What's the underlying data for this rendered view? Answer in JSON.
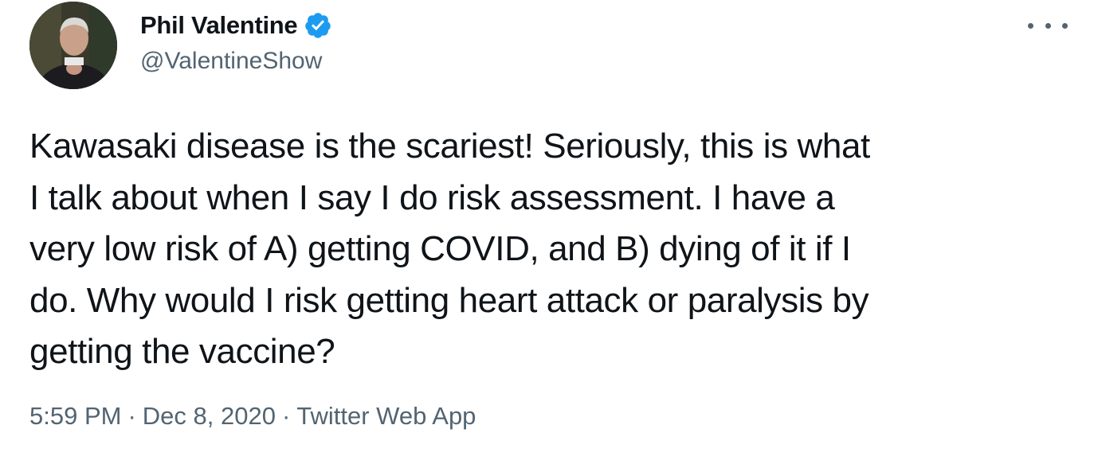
{
  "author": {
    "display_name": "Phil Valentine",
    "handle": "@ValentineShow",
    "verified": true,
    "verified_color": "#1d9bf0"
  },
  "tweet": {
    "text_lines": [
      "Kawasaki disease is the scariest! Seriously, this is what",
      "I talk about when I say I do risk assessment. I have a",
      "very low risk of A) getting COVID, and B) dying of it if I",
      "do. Why would I risk getting heart attack or paralysis by",
      "getting the vaccine?"
    ]
  },
  "meta": {
    "time": "5:59 PM",
    "separator": "·",
    "date": "Dec 8, 2020",
    "source": "Twitter Web App"
  },
  "icons": {
    "more": "more-horizontal-icon",
    "verified": "verified-badge-icon"
  }
}
